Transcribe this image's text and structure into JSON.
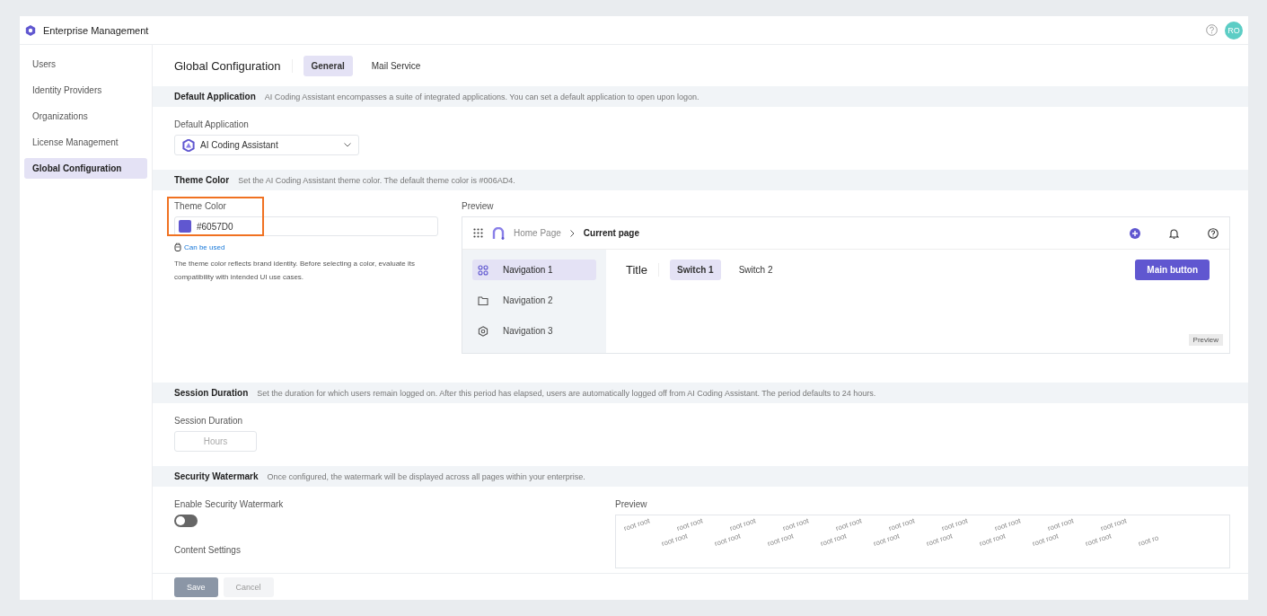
{
  "header": {
    "title": "Enterprise Management",
    "avatar": "RO"
  },
  "sidebar": {
    "items": [
      {
        "label": "Users",
        "selected": false
      },
      {
        "label": "Identity Providers",
        "selected": false
      },
      {
        "label": "Organizations",
        "selected": false
      },
      {
        "label": "License Management",
        "selected": false
      },
      {
        "label": "Global Configuration",
        "selected": true
      }
    ]
  },
  "page": {
    "title": "Global Configuration",
    "tabs": [
      {
        "label": "General",
        "selected": true
      },
      {
        "label": "Mail Service",
        "selected": false
      }
    ]
  },
  "sections": [
    {
      "kind": "default_app",
      "heading": "Default Application",
      "description": "AI Coding Assistant encompasses a suite of integrated applications. You can set a default application to open upon logon.",
      "field_label": "Default Application",
      "value": "AI Coding Assistant"
    },
    {
      "kind": "theme",
      "heading": "Theme Color",
      "description": "Set the AI Coding Assistant theme color. The default theme color is #006AD4.",
      "field_label": "Theme Color",
      "value": "#6057D0",
      "color": "#6057d0",
      "highlighted": true,
      "status": "Can be used",
      "hint": "The theme color reflects brand identity. Before selecting a color, evaluate its compatibility with intended UI use cases.",
      "preview": {
        "label": "Preview",
        "breadcrumb": [
          "Home Page",
          "Current page"
        ],
        "nav": [
          {
            "label": "Navigation 1",
            "selected": true
          },
          {
            "label": "Navigation 2",
            "selected": false
          },
          {
            "label": "Navigation 3",
            "selected": false
          }
        ],
        "title": "Title",
        "switches": [
          {
            "label": "Switch 1",
            "selected": true
          },
          {
            "label": "Switch 2",
            "selected": false
          }
        ],
        "main_button": "Main button",
        "tag": "Preview"
      }
    },
    {
      "kind": "session",
      "heading": "Session Duration",
      "description": "Set the duration for which users remain logged on. After this period has elapsed, users are automatically logged off from AI Coding Assistant. The period defaults to 24 hours.",
      "field_label": "Session Duration",
      "unit": "Hours"
    },
    {
      "kind": "watermark",
      "heading": "Security Watermark",
      "description": "Once configured, the watermark will be displayed across all pages within your enterprise.",
      "toggle_label": "Enable Security Watermark",
      "on": false,
      "content_label": "Content Settings",
      "preview_label": "Preview",
      "marks": [
        [
          "root root",
          "root root",
          "root root",
          "root root",
          "root root",
          "root root",
          "root root",
          "root root",
          "root root",
          "root root"
        ],
        [
          "root root",
          "root root",
          "root root",
          "root root",
          "root root",
          "root root",
          "root root",
          "root root",
          "root root",
          "root ro"
        ]
      ]
    }
  ],
  "footer": {
    "buttons": [
      {
        "label": "Save",
        "kind": "primary",
        "disabled": true
      },
      {
        "label": "Cancel",
        "kind": "secondary",
        "disabled": true
      }
    ]
  }
}
